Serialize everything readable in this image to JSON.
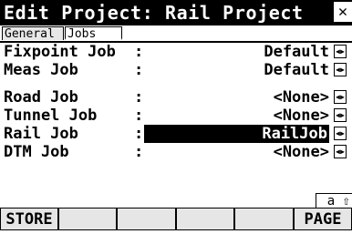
{
  "window": {
    "title": "Edit Project: Rail Project",
    "close_glyph": "✕"
  },
  "tabs": [
    {
      "label": "General",
      "active": false
    },
    {
      "label": "Jobs",
      "active": true
    }
  ],
  "fields": [
    {
      "label": "Fixpoint Job",
      "colon": ":",
      "value": "Default",
      "selected": false
    },
    {
      "label": "Meas Job",
      "colon": ":",
      "value": "Default",
      "selected": false
    },
    {
      "label": "Road Job",
      "colon": ":",
      "value": "<None>",
      "selected": false
    },
    {
      "label": "Tunnel Job",
      "colon": ":",
      "value": "<None>",
      "selected": false
    },
    {
      "label": "Rail Job",
      "colon": ":",
      "value": "RailJob",
      "selected": true
    },
    {
      "label": "DTM Job",
      "colon": ":",
      "value": "<None>",
      "selected": false
    }
  ],
  "status": {
    "input_mode": "a ⇧"
  },
  "softkeys": [
    "STORE",
    "",
    "",
    "",
    "",
    "PAGE"
  ]
}
